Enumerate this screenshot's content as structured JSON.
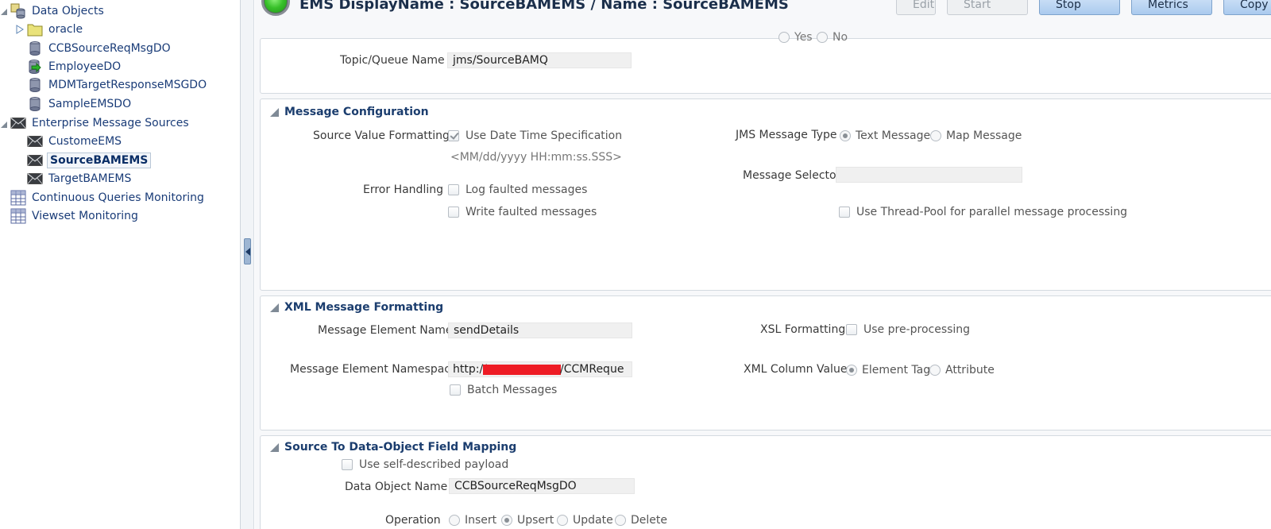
{
  "sidebar": {
    "items": [
      {
        "label": "Data Objects"
      },
      {
        "label": "oracle"
      },
      {
        "label": "CCBSourceReqMsgDO"
      },
      {
        "label": "EmployeeDO"
      },
      {
        "label": "MDMTargetResponseMSGDO"
      },
      {
        "label": "SampleEMSDO"
      },
      {
        "label": "Enterprise Message Sources"
      },
      {
        "label": "CustomeEMS"
      },
      {
        "label": "SourceBAMEMS"
      },
      {
        "label": "TargetBAMEMS"
      },
      {
        "label": "Continuous Queries Monitoring"
      },
      {
        "label": "Viewset Monitoring"
      }
    ]
  },
  "header": {
    "title": "EMS DisplayName : SourceBAMEMS / Name : SourceBAMEMS",
    "buttons": {
      "edit": "Edit",
      "start": "Start",
      "stop": "Stop",
      "metrics": "Metrics",
      "copy": "Copy E"
    }
  },
  "connection": {
    "topic_label": "Topic/Queue Name",
    "topic_value": "jms/SourceBAMQ",
    "partial_yes": "Yes",
    "partial_no": "No"
  },
  "message_config": {
    "title": "Message Configuration",
    "source_value_formatting_label": "Source Value Formatting",
    "use_datetime_label": "Use Date Time Specification",
    "use_datetime_checked": true,
    "datetime_format": "<MM/dd/yyyy HH:mm:ss.SSS>",
    "error_handling_label": "Error Handling",
    "log_faulted_label": "Log faulted messages",
    "write_faulted_label": "Write faulted messages",
    "jms_type_label": "JMS Message Type",
    "text_message_label": "Text Message",
    "map_message_label": "Map Message",
    "jms_type_selected": "Text Message",
    "message_selector_label": "Message Selector",
    "message_selector_value": "",
    "thread_pool_label": "Use Thread-Pool for parallel message processing"
  },
  "xml_formatting": {
    "title": "XML Message Formatting",
    "element_name_label": "Message Element Name",
    "element_name_value": "sendDetails",
    "namespace_label": "Message Element Namespace",
    "namespace_prefix": "http://",
    "namespace_suffix": "/CCMReque",
    "batch_label": "Batch Messages",
    "xsl_label": "XSL Formatting",
    "preprocessing_label": "Use pre-processing",
    "xml_column_label": "XML Column Value",
    "element_tag_label": "Element Tag",
    "attribute_label": "Attribute",
    "xml_column_selected": "Element Tag"
  },
  "mapping": {
    "title": "Source To Data-Object Field Mapping",
    "self_described_label": "Use self-described payload",
    "do_name_label": "Data Object Name",
    "do_name_value": "CCBSourceReqMsgDO",
    "operation_label": "Operation",
    "op_insert": "Insert",
    "op_upsert": "Upsert",
    "op_update": "Update",
    "op_delete": "Delete",
    "op_selected": "Upsert"
  },
  "colors": {
    "link": "#1a3c78",
    "section_title": "#1b3d6e",
    "button_active": "#aacaee",
    "status_green": "#38c12a",
    "redaction": "#ee1c25"
  }
}
